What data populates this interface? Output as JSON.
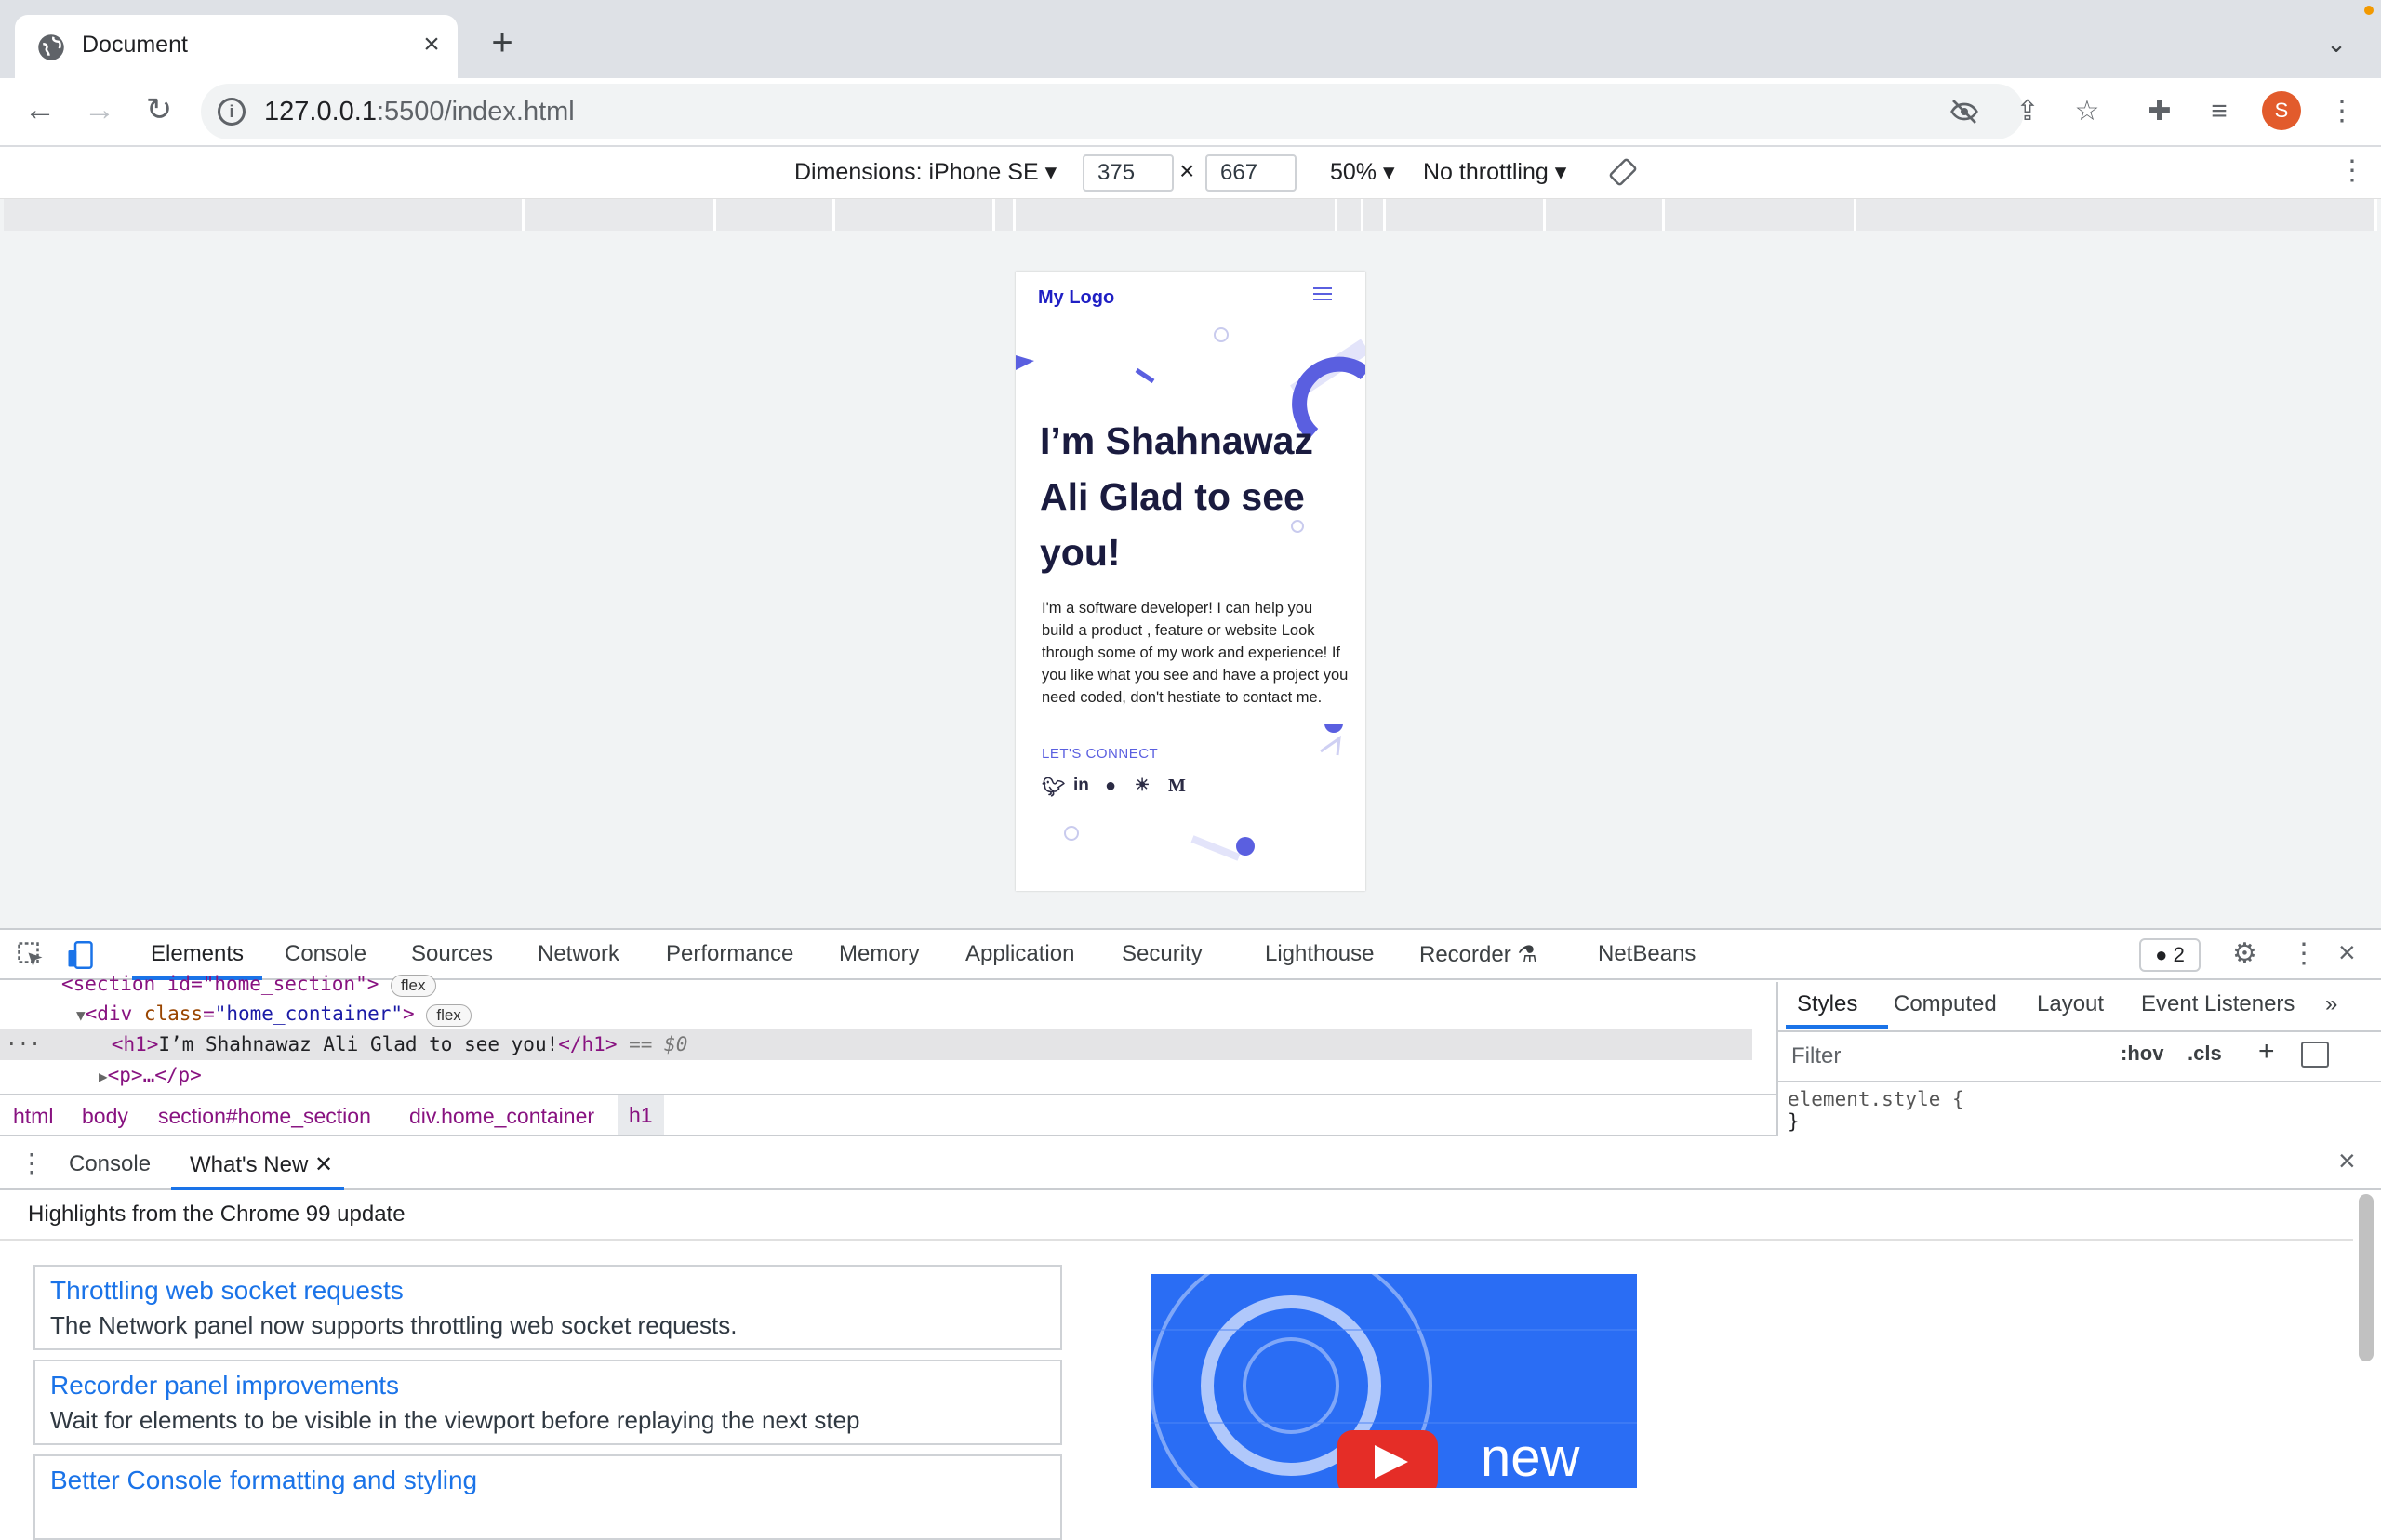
{
  "browser": {
    "tab_title": "Document",
    "url_host": "127.0.0.1",
    "url_rest": ":5500/index.html",
    "profile_initial": "S"
  },
  "device_toolbar": {
    "dimensions_label": "Dimensions: iPhone SE",
    "width": "375",
    "height": "667",
    "times": "×",
    "zoom": "50%",
    "throttling": "No throttling"
  },
  "page": {
    "logo": "My Logo",
    "heading": "I’m Shahnawaz Ali Glad to see you!",
    "description": "I'm a software developer! I can help you build a product , feature or website Look through some of my work and experience! If you like what you see and have a project you need coded, don't hestiate to contact me.",
    "connect": "LET'S CONNECT",
    "social_icons": [
      "twitter-icon",
      "linkedin-icon",
      "github-icon",
      "gitlab-icon",
      "medium-icon"
    ],
    "accent_color": "#5a5fe0"
  },
  "devtools": {
    "tabs": [
      "Elements",
      "Console",
      "Sources",
      "Network",
      "Performance",
      "Memory",
      "Application",
      "Security",
      "Lighthouse",
      "Recorder",
      "NetBeans"
    ],
    "issues_count": "2",
    "elements": {
      "line0": "<section id=\"home_section\">",
      "line1_tag": "<div ",
      "line1_attr": "class",
      "line1_val": "\"home_container\"",
      "flex": "flex",
      "line2_open": "<h1>",
      "line2_text": "I’m Shahnawaz Ali Glad to see you!",
      "line2_close": "</h1>",
      "line2_marker": "== $0",
      "line3": "<p>…</p>"
    },
    "breadcrumbs": [
      "html",
      "body",
      "section#home_section",
      "div.home_container",
      "h1"
    ],
    "styles_tabs": [
      "Styles",
      "Computed",
      "Layout",
      "Event Listeners"
    ],
    "filter_placeholder": "Filter",
    "hov": ":hov",
    "cls": ".cls",
    "element_style": "element.style {",
    "close_brace": "}",
    "drawer_tabs": [
      "Console",
      "What's New"
    ],
    "whats_new_heading": "Highlights from the Chrome 99 update",
    "cards": [
      {
        "title": "Throttling web socket requests",
        "desc": "The Network panel now supports throttling web socket requests."
      },
      {
        "title": "Recorder panel improvements",
        "desc": "Wait for elements to be visible in the viewport before replaying the next step"
      },
      {
        "title": "Better Console formatting and styling",
        "desc": ""
      }
    ],
    "video_text": "new"
  }
}
